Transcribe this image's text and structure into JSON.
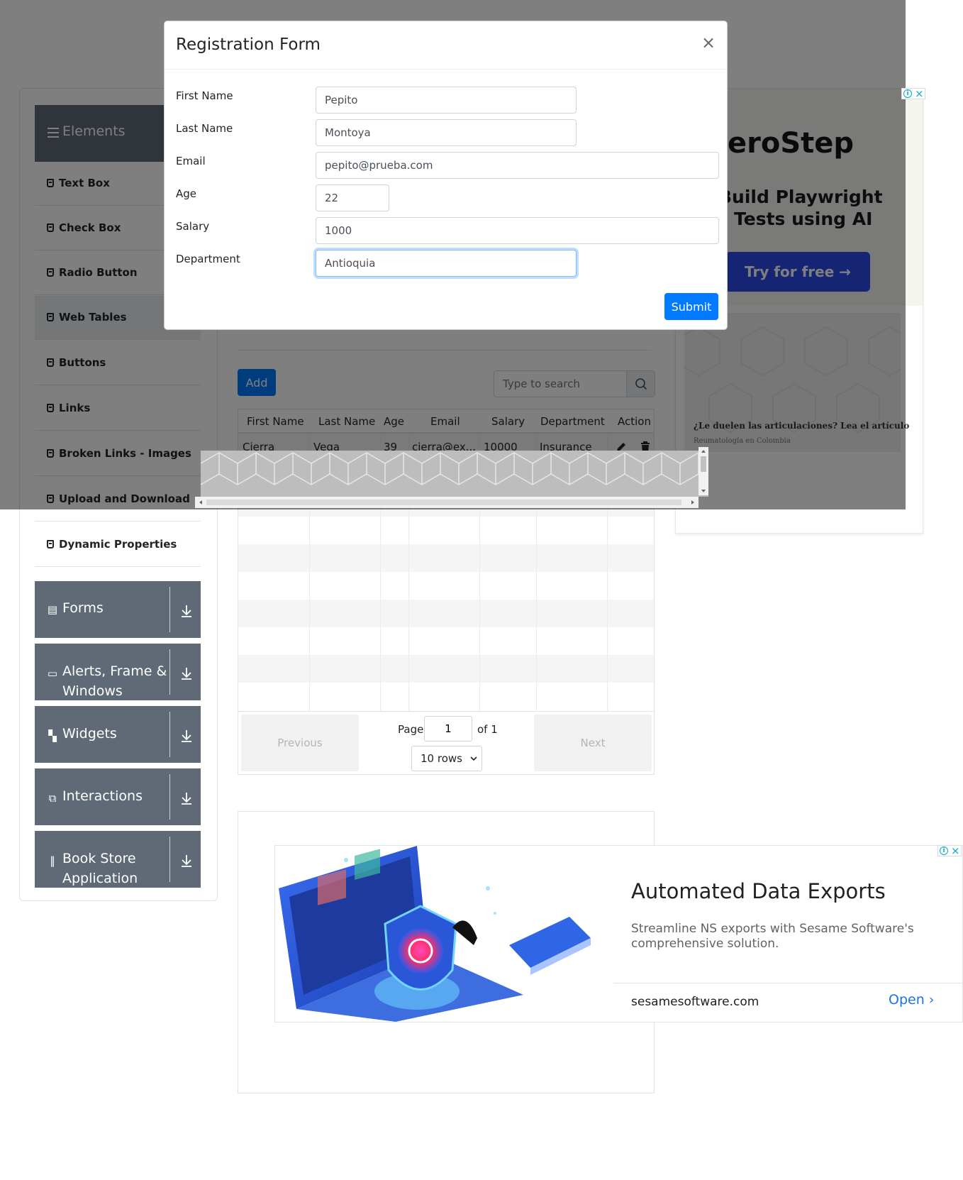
{
  "sidebar": {
    "group_label": "Elements",
    "items": [
      {
        "label": "Text Box"
      },
      {
        "label": "Check Box"
      },
      {
        "label": "Radio Button"
      },
      {
        "label": "Web Tables"
      },
      {
        "label": "Buttons"
      },
      {
        "label": "Links"
      },
      {
        "label": "Broken Links - Images"
      },
      {
        "label": "Upload and Download"
      },
      {
        "label": "Dynamic Properties"
      }
    ],
    "categories": [
      {
        "label": "Forms",
        "icon": "document-icon"
      },
      {
        "label": "Alerts, Frame &",
        "label2": "Windows",
        "icon": "window-icon"
      },
      {
        "label": "Widgets",
        "icon": "widgets-icon"
      },
      {
        "label": "Interactions",
        "icon": "interactions-icon"
      },
      {
        "label": "Book Store",
        "label2": "Application",
        "icon": "books-icon"
      }
    ]
  },
  "toolbar": {
    "add_label": "Add",
    "search_placeholder": "Type to search"
  },
  "table": {
    "headers": [
      "First Name",
      "Last Name",
      "Age",
      "Email",
      "Salary",
      "Department",
      "Action"
    ],
    "rows": [
      [
        "Cierra",
        "Vega",
        "39",
        "cierra@ex...",
        "10000",
        "Insurance"
      ]
    ]
  },
  "pagination": {
    "previous": "Previous",
    "next": "Next",
    "page_label": "Page",
    "page_value": "1",
    "of_label": "of 1",
    "rows_select": "10 rows"
  },
  "modal": {
    "title": "Registration Form",
    "close": "×",
    "fields": [
      {
        "label": "First Name",
        "value": "Pepito"
      },
      {
        "label": "Last Name",
        "value": "Montoya"
      },
      {
        "label": "Email",
        "value": "pepito@prueba.com"
      },
      {
        "label": "Age",
        "value": "22"
      },
      {
        "label": "Salary",
        "value": "1000"
      },
      {
        "label": "Department",
        "value": "Antioquia"
      }
    ],
    "submit": "Submit"
  },
  "ad_right": {
    "brand": "ZeroStep",
    "tagline1": "Build Playwright",
    "tagline2": "Tests using AI",
    "cta": "Try for free →",
    "headline": "¿Le duelen las articulaciones? Lea el artículo",
    "source": "Reumatología en Colombia"
  },
  "ad_bottom": {
    "title": "Automated Data Exports",
    "description": "Streamline NS exports with Sesame Software's comprehensive solution.",
    "url": "sesamesoftware.com",
    "open": "Open"
  },
  "colors": {
    "primary": "#007bff",
    "sidebar_dark": "#5f6a76",
    "overlay": "rgba(0,0,0,0.5)",
    "ad_cta": "#2b4be9"
  }
}
